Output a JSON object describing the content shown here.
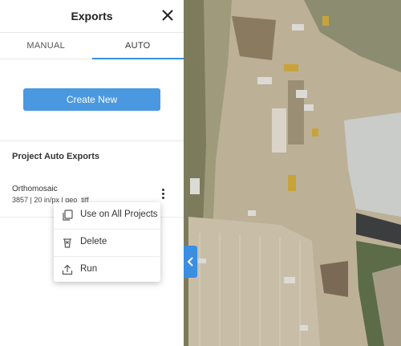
{
  "header": {
    "title": "Exports"
  },
  "tabs": [
    {
      "label": "MANUAL"
    },
    {
      "label": "AUTO"
    }
  ],
  "create_button": {
    "label": "Create New"
  },
  "section": {
    "title": "Project Auto Exports"
  },
  "export_item": {
    "name": "Orthomosaic",
    "meta": "3857 | 20 in/px | geo_tiff"
  },
  "context_menu": [
    {
      "label": "Use on All Projects",
      "icon": "copy-icon"
    },
    {
      "label": "Delete",
      "icon": "trash-icon"
    },
    {
      "label": "Run",
      "icon": "run-export-icon"
    }
  ],
  "colors": {
    "accent": "#4a98e0",
    "active_tab_underline": "#3b8ee0"
  }
}
